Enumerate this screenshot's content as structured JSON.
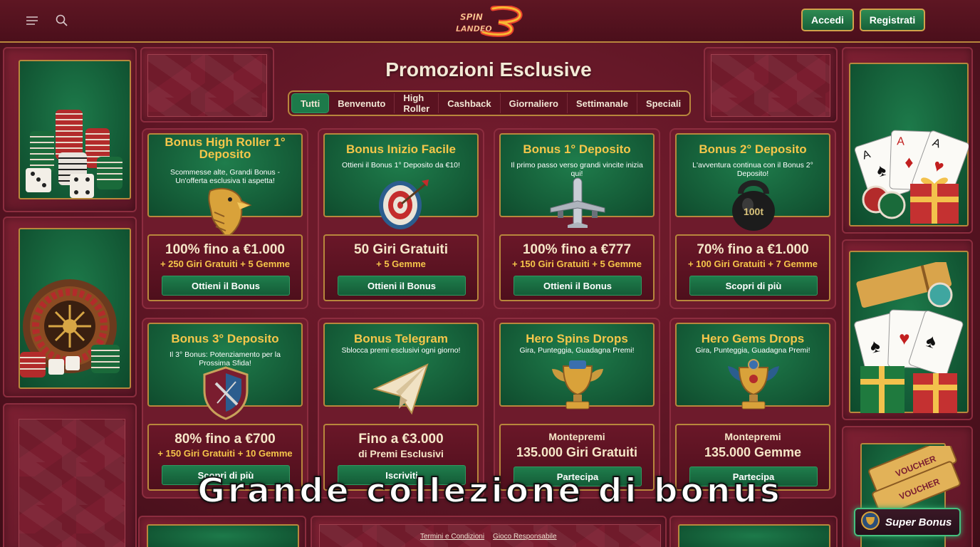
{
  "header": {
    "logo_text": [
      "SPIN",
      "LANDEO"
    ],
    "login_label": "Accedi",
    "register_label": "Registrati"
  },
  "title": "Promozioni Esclusive",
  "tabs": [
    {
      "label": "Tutti",
      "active": true
    },
    {
      "label": "Benvenuto",
      "active": false
    },
    {
      "label": "High Roller",
      "active": false
    },
    {
      "label": "Cashback",
      "active": false
    },
    {
      "label": "Giornaliero",
      "active": false
    },
    {
      "label": "Settimanale",
      "active": false
    },
    {
      "label": "Speciali",
      "active": false
    }
  ],
  "cards": [
    {
      "title": "Bonus High Roller 1° Deposito",
      "desc": "Scommesse alte, Grandi Bonus - Un'offerta esclusiva ti aspetta!",
      "icon": "eagle-icon",
      "amount": "100% fino a €1.000",
      "sub": "+ 250 Giri Gratuiti + 5 Gemme",
      "button": "Ottieni il Bonus"
    },
    {
      "title": "Bonus Inizio Facile",
      "desc": "Ottieni il Bonus 1° Deposito da €10!",
      "icon": "target-icon",
      "amount": "50 Giri Gratuiti",
      "sub": "+ 5 Gemme",
      "button": "Ottieni il Bonus"
    },
    {
      "title": "Bonus 1° Deposito",
      "desc": "Il primo passo verso grandi vincite inizia qui!",
      "icon": "airplane-icon",
      "amount": "100% fino a €777",
      "sub": "+ 150 Giri Gratuiti + 5 Gemme",
      "button": "Ottieni il Bonus"
    },
    {
      "title": "Bonus 2° Deposito",
      "desc": "L'avventura continua con il Bonus 2° Deposito!",
      "icon": "kettlebell-icon",
      "icon_text": "100t",
      "amount": "70% fino a €1.000",
      "sub": "+ 100 Giri Gratuiti + 7 Gemme",
      "button": "Scopri di più"
    },
    {
      "title": "Bonus 3° Deposito",
      "desc": "Il 3° Bonus: Potenziamento per la Prossima Sfida!",
      "icon": "shield-icon",
      "amount": "80% fino a €700",
      "sub": "+ 150 Giri Gratuiti + 10 Gemme",
      "button": "Scopri di più"
    },
    {
      "title": "Bonus Telegram",
      "desc": "Sblocca premi esclusivi ogni giorno!",
      "icon": "paper-plane-icon",
      "amount": "Fino a €3.000",
      "sub": "di Premi Esclusivi",
      "button": "Iscriviti"
    },
    {
      "title": "Hero Spins Drops",
      "desc": "Gira, Punteggia, Guadagna Premi!",
      "icon": "trophy-icon",
      "amount_label": "Montepremi",
      "amount": "135.000 Giri Gratuiti",
      "button": "Partecipa"
    },
    {
      "title": "Hero Gems Drops",
      "desc": "Gira, Punteggia, Guadagna Premi!",
      "icon": "trophy-gems-icon",
      "amount_label": "Montepremi",
      "amount": "135.000 Gemme",
      "button": "Partecipa"
    }
  ],
  "decor": {
    "left": [
      "casino-chips-dice-icon",
      "roulette-icon"
    ],
    "right": [
      "playing-cards-gift-icon",
      "ticket-cards-gifts-icon",
      "voucher-icon"
    ],
    "voucher_text": "VOUCHER"
  },
  "overlay_caption": "Grande collezione di bonus",
  "footer": {
    "terms": "Termini e Condizioni",
    "responsible": "Gioco Responsabile"
  },
  "super_bonus_label": "Super Bonus",
  "colors": {
    "background": "#5c1524",
    "accent_gold": "#b8873c",
    "felt_green": "#1d7a4a",
    "title_yellow": "#f5c64a"
  }
}
